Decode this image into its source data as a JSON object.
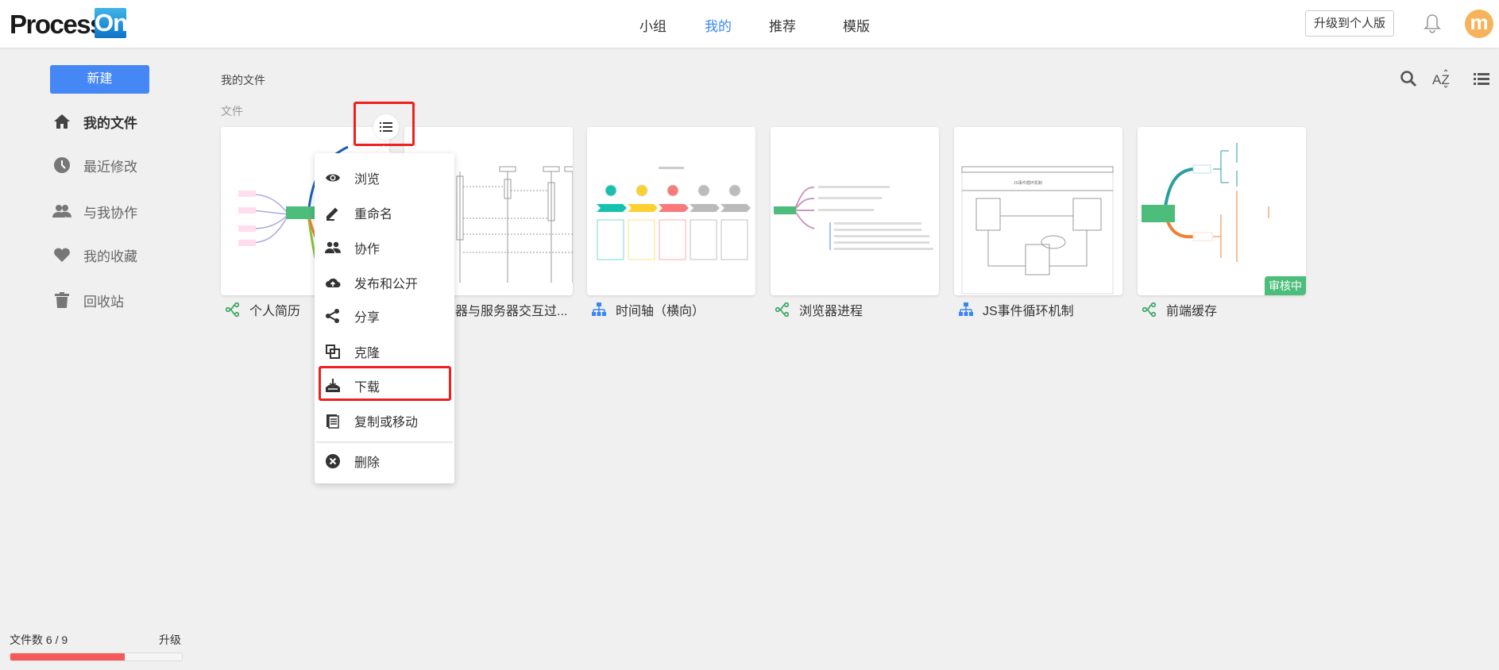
{
  "header": {
    "logo": {
      "text": "Process",
      "badge": "On"
    },
    "nav": [
      {
        "label": "小组"
      },
      {
        "label": "我的",
        "active": true
      },
      {
        "label": "推荐"
      },
      {
        "label": "模版"
      }
    ],
    "upgrade_button": "升级到个人版",
    "avatar_letter": "m",
    "icons": [
      "bell-icon"
    ]
  },
  "sidebar": {
    "new_button": "新建",
    "items": [
      {
        "label": "我的文件",
        "icon": "home-icon",
        "active": true
      },
      {
        "label": "最近修改",
        "icon": "clock-icon"
      },
      {
        "label": "与我协作",
        "icon": "people-icon"
      },
      {
        "label": "我的收藏",
        "icon": "heart-icon"
      },
      {
        "label": "回收站",
        "icon": "trash-icon"
      }
    ],
    "file_count": "文件数 6 / 9",
    "upgrade": "升级",
    "usage_fraction": 0.667
  },
  "main": {
    "breadcrumb": "我的文件",
    "section": "文件",
    "tools": [
      "search-icon",
      "sort-az-icon",
      "list-view-icon"
    ],
    "files": [
      {
        "title": "个人简历",
        "type": "mindmap"
      },
      {
        "title": "器与服务器交互过...",
        "type": "flowchart"
      },
      {
        "title": "时间轴（横向）",
        "type": "flowchart"
      },
      {
        "title": "浏览器进程",
        "type": "mindmap"
      },
      {
        "title": "JS事件循环机制",
        "type": "flowchart"
      },
      {
        "title": "前端缓存",
        "type": "mindmap",
        "badge": "审核中"
      }
    ]
  },
  "context_menu": {
    "items": [
      {
        "label": "浏览",
        "icon": "eye-icon"
      },
      {
        "label": "重命名",
        "icon": "pencil-icon"
      },
      {
        "label": "协作",
        "icon": "people-icon"
      },
      {
        "label": "发布和公开",
        "icon": "cloud-upload-icon"
      },
      {
        "label": "分享",
        "icon": "share-icon"
      },
      {
        "label": "克隆",
        "icon": "clone-icon"
      },
      {
        "label": "下载",
        "icon": "download-icon",
        "highlighted": true
      },
      {
        "label": "复制或移动",
        "icon": "copy-icon"
      },
      {
        "label": "删除",
        "icon": "delete-icon"
      }
    ]
  },
  "colors": {
    "accent": "#4587f5",
    "highlight": "#f0201d",
    "badge": "#4cbd7a",
    "progress": "#f55a5a",
    "avatar": "#f7b35b"
  }
}
